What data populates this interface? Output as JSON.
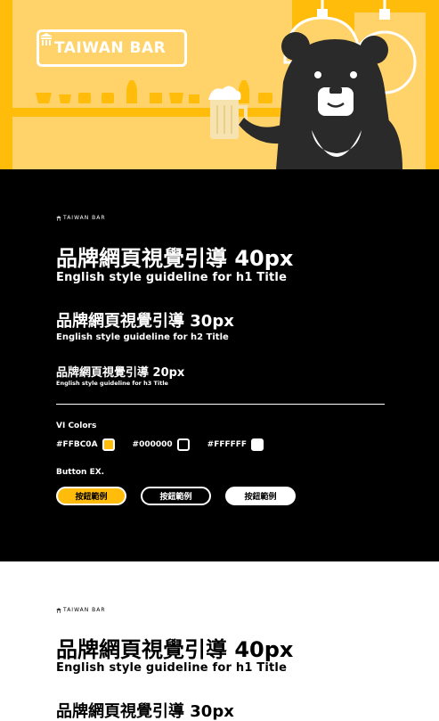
{
  "brand": {
    "name": "TAIWAN BAR",
    "mini_logo": "TAIWAN BAR"
  },
  "colors": {
    "primary": "#FFBC0A",
    "black": "#000000",
    "white": "#FFFFFF"
  },
  "dark_section": {
    "h1": "品牌網頁視覺引導 40px",
    "h1_en": "English style guideline for h1 Title",
    "h2": "品牌網頁視覺引導 30px",
    "h2_en": "English style guideline for h2 Title",
    "h3": "品牌網頁視覺引導 20px",
    "h3_en": "English style guideline for h3 Title",
    "vi_colors_label": "VI Colors",
    "swatches": [
      {
        "code": "#FFBC0A",
        "color": "#FFBC0A"
      },
      {
        "code": "#000000",
        "color": "#000000"
      },
      {
        "code": "#FFFFFF",
        "color": "#FFFFFF"
      }
    ],
    "button_label": "Button EX.",
    "buttons": [
      "按鈕範例",
      "按鈕範例",
      "按鈕範例"
    ]
  },
  "light_section": {
    "h1": "品牌網頁視覺引導 40px",
    "h1_en": "English style guideline for h1 Title",
    "h2": "品牌網頁視覺引導 30px"
  }
}
